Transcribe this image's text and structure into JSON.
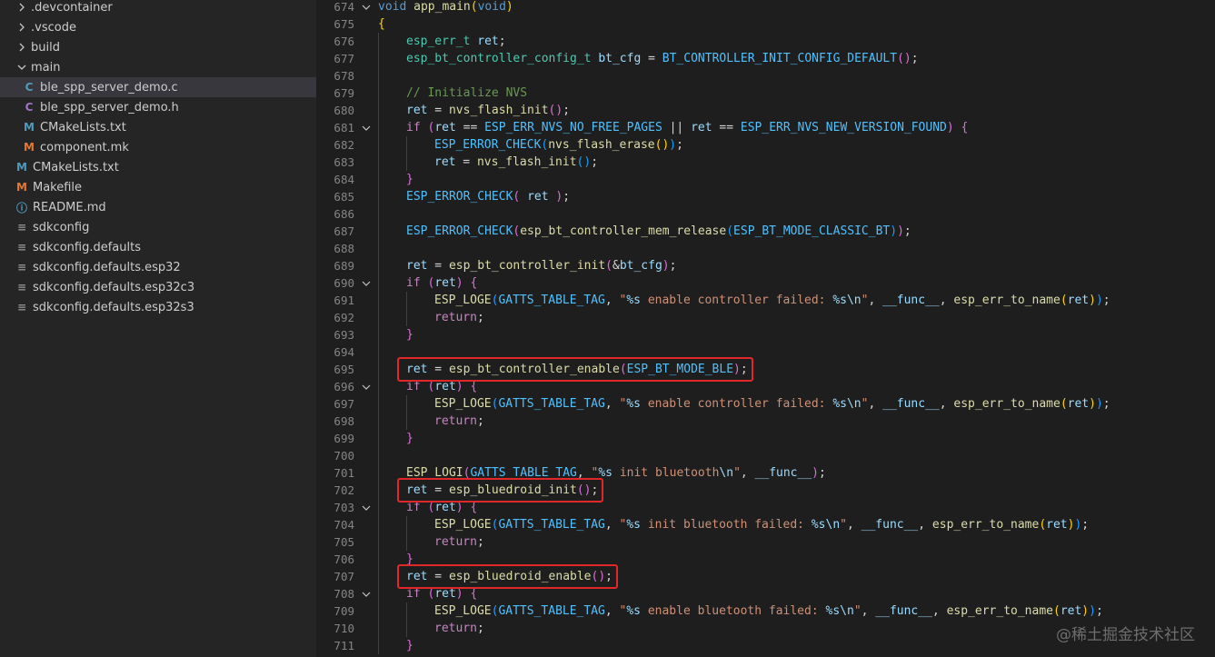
{
  "explorer": {
    "items": [
      {
        "label": ".devcontainer",
        "type": "folder",
        "expanded": false,
        "depth": 1,
        "icon": "chevron-right-icon"
      },
      {
        "label": ".vscode",
        "type": "folder",
        "expanded": false,
        "depth": 1,
        "icon": "chevron-right-icon"
      },
      {
        "label": "build",
        "type": "folder",
        "expanded": false,
        "depth": 1,
        "icon": "chevron-right-icon"
      },
      {
        "label": "main",
        "type": "folder",
        "expanded": true,
        "depth": 1,
        "icon": "chevron-down-icon"
      },
      {
        "label": "ble_spp_server_demo.c",
        "type": "file",
        "depth": 2,
        "icon": "c-file-icon",
        "glyph": "C",
        "selected": true
      },
      {
        "label": "ble_spp_server_demo.h",
        "type": "file",
        "depth": 2,
        "icon": "h-file-icon",
        "glyph": "C"
      },
      {
        "label": "CMakeLists.txt",
        "type": "file",
        "depth": 2,
        "icon": "cmake-file-icon",
        "glyph": "M"
      },
      {
        "label": "component.mk",
        "type": "file",
        "depth": 2,
        "icon": "makefile-icon",
        "glyph": "M"
      },
      {
        "label": "CMakeLists.txt",
        "type": "file",
        "depth": 1,
        "icon": "cmake-file-icon",
        "glyph": "M"
      },
      {
        "label": "Makefile",
        "type": "file",
        "depth": 1,
        "icon": "makefile-icon",
        "glyph": "M"
      },
      {
        "label": "README.md",
        "type": "file",
        "depth": 1,
        "icon": "info-icon",
        "glyph": "ⓘ"
      },
      {
        "label": "sdkconfig",
        "type": "file",
        "depth": 1,
        "icon": "settings-file-icon",
        "glyph": "≡"
      },
      {
        "label": "sdkconfig.defaults",
        "type": "file",
        "depth": 1,
        "icon": "settings-file-icon",
        "glyph": "≡"
      },
      {
        "label": "sdkconfig.defaults.esp32",
        "type": "file",
        "depth": 1,
        "icon": "settings-file-icon",
        "glyph": "≡"
      },
      {
        "label": "sdkconfig.defaults.esp32c3",
        "type": "file",
        "depth": 1,
        "icon": "settings-file-icon",
        "glyph": "≡"
      },
      {
        "label": "sdkconfig.defaults.esp32s3",
        "type": "file",
        "depth": 1,
        "icon": "settings-file-icon",
        "glyph": "≡"
      }
    ]
  },
  "editor": {
    "lines": [
      {
        "n": "674",
        "fold": "open",
        "indent": 0,
        "t": [
          [
            "kw",
            "void"
          ],
          [
            "pn",
            " "
          ],
          [
            "fn",
            "app_main"
          ],
          [
            "br1",
            "("
          ],
          [
            "kw",
            "void"
          ],
          [
            "br1",
            ")"
          ]
        ]
      },
      {
        "n": "675",
        "indent": 0,
        "t": [
          [
            "br1",
            "{"
          ]
        ]
      },
      {
        "n": "676",
        "indent": 1,
        "t": [
          [
            "ty",
            "esp_err_t"
          ],
          [
            "pn",
            " "
          ],
          [
            "var",
            "ret"
          ],
          [
            "pn",
            ";"
          ]
        ]
      },
      {
        "n": "677",
        "indent": 1,
        "t": [
          [
            "ty",
            "esp_bt_controller_config_t"
          ],
          [
            "pn",
            " "
          ],
          [
            "var",
            "bt_cfg"
          ],
          [
            "pn",
            " = "
          ],
          [
            "mac",
            "BT_CONTROLLER_INIT_CONFIG_DEFAULT"
          ],
          [
            "br2",
            "()"
          ],
          [
            "pn",
            ";"
          ]
        ]
      },
      {
        "n": "678",
        "indent": 0,
        "t": []
      },
      {
        "n": "679",
        "indent": 1,
        "t": [
          [
            "cm",
            "// Initialize NVS"
          ]
        ]
      },
      {
        "n": "680",
        "indent": 1,
        "t": [
          [
            "var",
            "ret"
          ],
          [
            "pn",
            " = "
          ],
          [
            "fn",
            "nvs_flash_init"
          ],
          [
            "br2",
            "()"
          ],
          [
            "pn",
            ";"
          ]
        ]
      },
      {
        "n": "681",
        "fold": "open",
        "indent": 1,
        "t": [
          [
            "ctl",
            "if"
          ],
          [
            "pn",
            " "
          ],
          [
            "br2",
            "("
          ],
          [
            "var",
            "ret"
          ],
          [
            "pn",
            " == "
          ],
          [
            "mac",
            "ESP_ERR_NVS_NO_FREE_PAGES"
          ],
          [
            "pn",
            " || "
          ],
          [
            "var",
            "ret"
          ],
          [
            "pn",
            " == "
          ],
          [
            "mac",
            "ESP_ERR_NVS_NEW_VERSION_FOUND"
          ],
          [
            "br2",
            ")"
          ],
          [
            "pn",
            " "
          ],
          [
            "br2",
            "{"
          ]
        ]
      },
      {
        "n": "682",
        "indent": 2,
        "t": [
          [
            "mac",
            "ESP_ERROR_CHECK"
          ],
          [
            "br3",
            "("
          ],
          [
            "fn",
            "nvs_flash_erase"
          ],
          [
            "br1",
            "()"
          ],
          [
            "br3",
            ")"
          ],
          [
            "pn",
            ";"
          ]
        ]
      },
      {
        "n": "683",
        "indent": 2,
        "t": [
          [
            "var",
            "ret"
          ],
          [
            "pn",
            " = "
          ],
          [
            "fn",
            "nvs_flash_init"
          ],
          [
            "br3",
            "()"
          ],
          [
            "pn",
            ";"
          ]
        ]
      },
      {
        "n": "684",
        "indent": 1,
        "t": [
          [
            "br2",
            "}"
          ]
        ]
      },
      {
        "n": "685",
        "indent": 1,
        "t": [
          [
            "mac",
            "ESP_ERROR_CHECK"
          ],
          [
            "br2",
            "("
          ],
          [
            "pn",
            " "
          ],
          [
            "var",
            "ret"
          ],
          [
            "pn",
            " "
          ],
          [
            "br2",
            ")"
          ],
          [
            "pn",
            ";"
          ]
        ]
      },
      {
        "n": "686",
        "indent": 0,
        "t": []
      },
      {
        "n": "687",
        "indent": 1,
        "t": [
          [
            "mac",
            "ESP_ERROR_CHECK"
          ],
          [
            "br2",
            "("
          ],
          [
            "fn",
            "esp_bt_controller_mem_release"
          ],
          [
            "br3",
            "("
          ],
          [
            "mac",
            "ESP_BT_MODE_CLASSIC_BT"
          ],
          [
            "br3",
            ")"
          ],
          [
            "br2",
            ")"
          ],
          [
            "pn",
            ";"
          ]
        ]
      },
      {
        "n": "688",
        "indent": 0,
        "t": []
      },
      {
        "n": "689",
        "indent": 1,
        "t": [
          [
            "var",
            "ret"
          ],
          [
            "pn",
            " = "
          ],
          [
            "fn",
            "esp_bt_controller_init"
          ],
          [
            "br2",
            "("
          ],
          [
            "pn",
            "&"
          ],
          [
            "var",
            "bt_cfg"
          ],
          [
            "br2",
            ")"
          ],
          [
            "pn",
            ";"
          ]
        ]
      },
      {
        "n": "690",
        "fold": "open",
        "indent": 1,
        "t": [
          [
            "ctl",
            "if"
          ],
          [
            "pn",
            " "
          ],
          [
            "br2",
            "("
          ],
          [
            "var",
            "ret"
          ],
          [
            "br2",
            ")"
          ],
          [
            "pn",
            " "
          ],
          [
            "br2",
            "{"
          ]
        ]
      },
      {
        "n": "691",
        "indent": 2,
        "t": [
          [
            "fn",
            "ESP_LOGE"
          ],
          [
            "br3",
            "("
          ],
          [
            "mac",
            "GATTS_TABLE_TAG"
          ],
          [
            "pn",
            ", "
          ],
          [
            "str",
            "\""
          ],
          [
            "fmt",
            "%s"
          ],
          [
            "str",
            " enable controller failed: "
          ],
          [
            "fmt",
            "%s\\n"
          ],
          [
            "str",
            "\""
          ],
          [
            "pn",
            ", "
          ],
          [
            "var",
            "__func__"
          ],
          [
            "pn",
            ", "
          ],
          [
            "fn",
            "esp_err_to_name"
          ],
          [
            "br1",
            "("
          ],
          [
            "var",
            "ret"
          ],
          [
            "br1",
            ")"
          ],
          [
            "br3",
            ")"
          ],
          [
            "pn",
            ";"
          ]
        ]
      },
      {
        "n": "692",
        "indent": 2,
        "t": [
          [
            "ctl",
            "return"
          ],
          [
            "pn",
            ";"
          ]
        ]
      },
      {
        "n": "693",
        "indent": 1,
        "t": [
          [
            "br2",
            "}"
          ]
        ]
      },
      {
        "n": "694",
        "indent": 0,
        "t": []
      },
      {
        "n": "695",
        "indent": 1,
        "t": [
          [
            "var",
            "ret"
          ],
          [
            "pn",
            " = "
          ],
          [
            "fn",
            "esp_bt_controller_enable"
          ],
          [
            "br2",
            "("
          ],
          [
            "mac",
            "ESP_BT_MODE_BLE"
          ],
          [
            "br2",
            ")"
          ],
          [
            "pn",
            ";"
          ]
        ]
      },
      {
        "n": "696",
        "fold": "open",
        "indent": 1,
        "t": [
          [
            "ctl",
            "if"
          ],
          [
            "pn",
            " "
          ],
          [
            "br2",
            "("
          ],
          [
            "var",
            "ret"
          ],
          [
            "br2",
            ")"
          ],
          [
            "pn",
            " "
          ],
          [
            "br2",
            "{"
          ]
        ]
      },
      {
        "n": "697",
        "indent": 2,
        "t": [
          [
            "fn",
            "ESP_LOGE"
          ],
          [
            "br3",
            "("
          ],
          [
            "mac",
            "GATTS_TABLE_TAG"
          ],
          [
            "pn",
            ", "
          ],
          [
            "str",
            "\""
          ],
          [
            "fmt",
            "%s"
          ],
          [
            "str",
            " enable controller failed: "
          ],
          [
            "fmt",
            "%s\\n"
          ],
          [
            "str",
            "\""
          ],
          [
            "pn",
            ", "
          ],
          [
            "var",
            "__func__"
          ],
          [
            "pn",
            ", "
          ],
          [
            "fn",
            "esp_err_to_name"
          ],
          [
            "br1",
            "("
          ],
          [
            "var",
            "ret"
          ],
          [
            "br1",
            ")"
          ],
          [
            "br3",
            ")"
          ],
          [
            "pn",
            ";"
          ]
        ]
      },
      {
        "n": "698",
        "indent": 2,
        "t": [
          [
            "ctl",
            "return"
          ],
          [
            "pn",
            ";"
          ]
        ]
      },
      {
        "n": "699",
        "indent": 1,
        "t": [
          [
            "br2",
            "}"
          ]
        ]
      },
      {
        "n": "700",
        "indent": 0,
        "t": []
      },
      {
        "n": "701",
        "indent": 1,
        "t": [
          [
            "fn",
            "ESP_LOGI"
          ],
          [
            "br2",
            "("
          ],
          [
            "mac",
            "GATTS_TABLE_TAG"
          ],
          [
            "pn",
            ", "
          ],
          [
            "str",
            "\""
          ],
          [
            "fmt",
            "%s"
          ],
          [
            "str",
            " init bluetooth"
          ],
          [
            "fmt",
            "\\n"
          ],
          [
            "str",
            "\""
          ],
          [
            "pn",
            ", "
          ],
          [
            "var",
            "__func__"
          ],
          [
            "br2",
            ")"
          ],
          [
            "pn",
            ";"
          ]
        ]
      },
      {
        "n": "702",
        "indent": 1,
        "t": [
          [
            "var",
            "ret"
          ],
          [
            "pn",
            " = "
          ],
          [
            "fn",
            "esp_bluedroid_init"
          ],
          [
            "br2",
            "()"
          ],
          [
            "pn",
            ";"
          ]
        ]
      },
      {
        "n": "703",
        "fold": "open",
        "indent": 1,
        "t": [
          [
            "ctl",
            "if"
          ],
          [
            "pn",
            " "
          ],
          [
            "br2",
            "("
          ],
          [
            "var",
            "ret"
          ],
          [
            "br2",
            ")"
          ],
          [
            "pn",
            " "
          ],
          [
            "br2",
            "{"
          ]
        ]
      },
      {
        "n": "704",
        "indent": 2,
        "t": [
          [
            "fn",
            "ESP_LOGE"
          ],
          [
            "br3",
            "("
          ],
          [
            "mac",
            "GATTS_TABLE_TAG"
          ],
          [
            "pn",
            ", "
          ],
          [
            "str",
            "\""
          ],
          [
            "fmt",
            "%s"
          ],
          [
            "str",
            " init bluetooth failed: "
          ],
          [
            "fmt",
            "%s\\n"
          ],
          [
            "str",
            "\""
          ],
          [
            "pn",
            ", "
          ],
          [
            "var",
            "__func__"
          ],
          [
            "pn",
            ", "
          ],
          [
            "fn",
            "esp_err_to_name"
          ],
          [
            "br1",
            "("
          ],
          [
            "var",
            "ret"
          ],
          [
            "br1",
            ")"
          ],
          [
            "br3",
            ")"
          ],
          [
            "pn",
            ";"
          ]
        ]
      },
      {
        "n": "705",
        "indent": 2,
        "t": [
          [
            "ctl",
            "return"
          ],
          [
            "pn",
            ";"
          ]
        ]
      },
      {
        "n": "706",
        "indent": 1,
        "t": [
          [
            "br2",
            "}"
          ]
        ]
      },
      {
        "n": "707",
        "indent": 1,
        "t": [
          [
            "var",
            "ret"
          ],
          [
            "pn",
            " = "
          ],
          [
            "fn",
            "esp_bluedroid_enable"
          ],
          [
            "br2",
            "()"
          ],
          [
            "pn",
            ";"
          ]
        ]
      },
      {
        "n": "708",
        "fold": "open",
        "indent": 1,
        "t": [
          [
            "ctl",
            "if"
          ],
          [
            "pn",
            " "
          ],
          [
            "br2",
            "("
          ],
          [
            "var",
            "ret"
          ],
          [
            "br2",
            ")"
          ],
          [
            "pn",
            " "
          ],
          [
            "br2",
            "{"
          ]
        ]
      },
      {
        "n": "709",
        "indent": 2,
        "t": [
          [
            "fn",
            "ESP_LOGE"
          ],
          [
            "br3",
            "("
          ],
          [
            "mac",
            "GATTS_TABLE_TAG"
          ],
          [
            "pn",
            ", "
          ],
          [
            "str",
            "\""
          ],
          [
            "fmt",
            "%s"
          ],
          [
            "str",
            " enable bluetooth failed: "
          ],
          [
            "fmt",
            "%s\\n"
          ],
          [
            "str",
            "\""
          ],
          [
            "pn",
            ", "
          ],
          [
            "var",
            "__func__"
          ],
          [
            "pn",
            ", "
          ],
          [
            "fn",
            "esp_err_to_name"
          ],
          [
            "br1",
            "("
          ],
          [
            "var",
            "ret"
          ],
          [
            "br1",
            ")"
          ],
          [
            "br3",
            ")"
          ],
          [
            "pn",
            ";"
          ]
        ]
      },
      {
        "n": "710",
        "indent": 2,
        "t": [
          [
            "ctl",
            "return"
          ],
          [
            "pn",
            ";"
          ]
        ]
      },
      {
        "n": "711",
        "indent": 1,
        "t": [
          [
            "br2",
            "}"
          ]
        ]
      }
    ],
    "highlighted_lines": [
      "695",
      "702",
      "707"
    ],
    "highlight_color": "#e0282a"
  },
  "watermark": "@稀土掘金技术社区"
}
